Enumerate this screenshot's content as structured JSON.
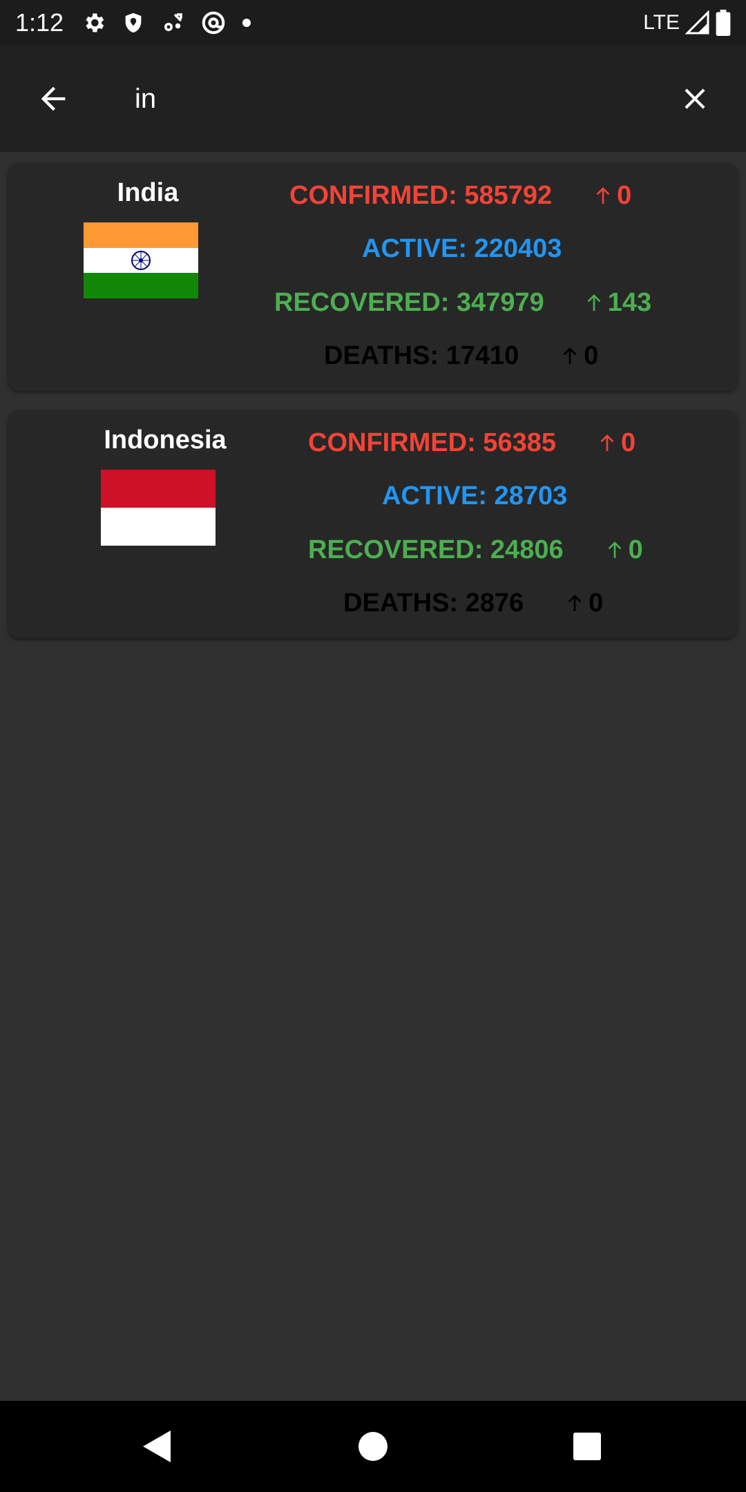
{
  "status_bar": {
    "time": "1:12",
    "network": "LTE"
  },
  "search": {
    "value": "in",
    "placeholder": ""
  },
  "colors": {
    "confirmed": "#f44336",
    "active": "#2196f3",
    "recovered": "#4caf50",
    "deaths": "#000000"
  },
  "countries": [
    {
      "name": "India",
      "confirmed_label": "CONFIRMED: 585792",
      "confirmed_delta": "0",
      "active_label": "ACTIVE: 220403",
      "recovered_label": "RECOVERED: 347979",
      "recovered_delta": "143",
      "deaths_label": "DEATHS: 17410",
      "deaths_delta": "0"
    },
    {
      "name": "Indonesia",
      "confirmed_label": "CONFIRMED: 56385",
      "confirmed_delta": "0",
      "active_label": "ACTIVE: 28703",
      "recovered_label": "RECOVERED: 24806",
      "recovered_delta": "0",
      "deaths_label": "DEATHS: 2876",
      "deaths_delta": "0"
    }
  ],
  "icons": {
    "back": "arrow-back-icon",
    "clear": "close-icon",
    "nav_back": "triangle-back-icon",
    "nav_home": "circle-home-icon",
    "nav_recents": "square-recents-icon"
  }
}
